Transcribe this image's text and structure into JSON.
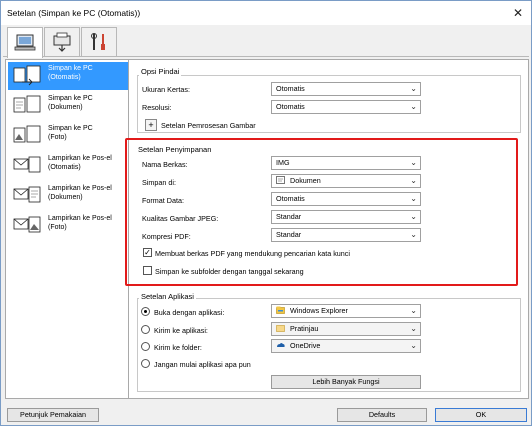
{
  "window": {
    "title": "Setelan (Simpan ke PC (Otomatis))",
    "close_glyph": "✕"
  },
  "top_tabs": [
    {
      "name": "scan-from-computer",
      "icon": "computer-icon"
    },
    {
      "name": "scan-from-operation-panel",
      "icon": "printer-scan-icon"
    },
    {
      "name": "general-settings",
      "icon": "tools-icon"
    }
  ],
  "sidebar": {
    "items": [
      {
        "label_line1": "Simpan ke PC",
        "label_line2": "(Otomatis)",
        "icon": "auto-scan-icon",
        "active": true
      },
      {
        "label_line1": "Simpan ke PC",
        "label_line2": "(Dokumen)",
        "icon": "document-scan-icon"
      },
      {
        "label_line1": "Simpan ke PC",
        "label_line2": "(Foto)",
        "icon": "photo-scan-icon"
      },
      {
        "label_line1": "Lampirkan ke Pos-el",
        "label_line2": "(Otomatis)",
        "icon": "email-auto-icon"
      },
      {
        "label_line1": "Lampirkan ke Pos-el",
        "label_line2": "(Dokumen)",
        "icon": "email-document-icon"
      },
      {
        "label_line1": "Lampirkan ke Pos-el",
        "label_line2": "(Foto)",
        "icon": "email-photo-icon"
      }
    ]
  },
  "scan_options": {
    "title": "Opsi Pindai",
    "paper_size_label": "Ukuran Kertas:",
    "paper_size_value": "Otomatis",
    "resolution_label": "Resolusi:",
    "resolution_value": "Otomatis",
    "image_processing_label": "Setelan Pemrosesan Gambar",
    "expand_glyph": "+"
  },
  "save_settings": {
    "title": "Setelan Penyimpanan",
    "file_name_label": "Nama Berkas:",
    "file_name_value": "IMG",
    "save_in_label": "Simpan di:",
    "save_in_value": "Dokumen",
    "data_format_label": "Format Data:",
    "data_format_value": "Otomatis",
    "jpeg_quality_label": "Kualitas Gambar JPEG:",
    "jpeg_quality_value": "Standar",
    "pdf_compression_label": "Kompresi PDF:",
    "pdf_compression_value": "Standar",
    "keyword_pdf_label": "Membuat berkas PDF yang mendukung pencarian kata kunci",
    "keyword_pdf_checked": true,
    "subfolder_label": "Simpan ke subfolder dengan tanggal sekarang",
    "subfolder_checked": false,
    "check_glyph": "✓"
  },
  "app_settings": {
    "title": "Setelan Aplikasi",
    "open_with_label": "Buka dengan aplikasi:",
    "open_with_value": "Windows Explorer",
    "send_to_app_label": "Kirim ke aplikasi:",
    "send_to_app_value": "Pratinjau",
    "send_to_folder_label": "Kirim ke folder:",
    "send_to_folder_value": "OneDrive",
    "no_app_label": "Jangan mulai aplikasi apa pun",
    "selected_option": "open_with",
    "more_functions_label": "Lebih Banyak Fungsi"
  },
  "footer": {
    "instructions_label": "Petunjuk Pemakaian",
    "defaults_label": "Defaults",
    "ok_label": "OK"
  },
  "dropdown_glyph": "⌄",
  "colors": {
    "selection": "#3399ff",
    "highlight_box": "#e21a1a"
  }
}
